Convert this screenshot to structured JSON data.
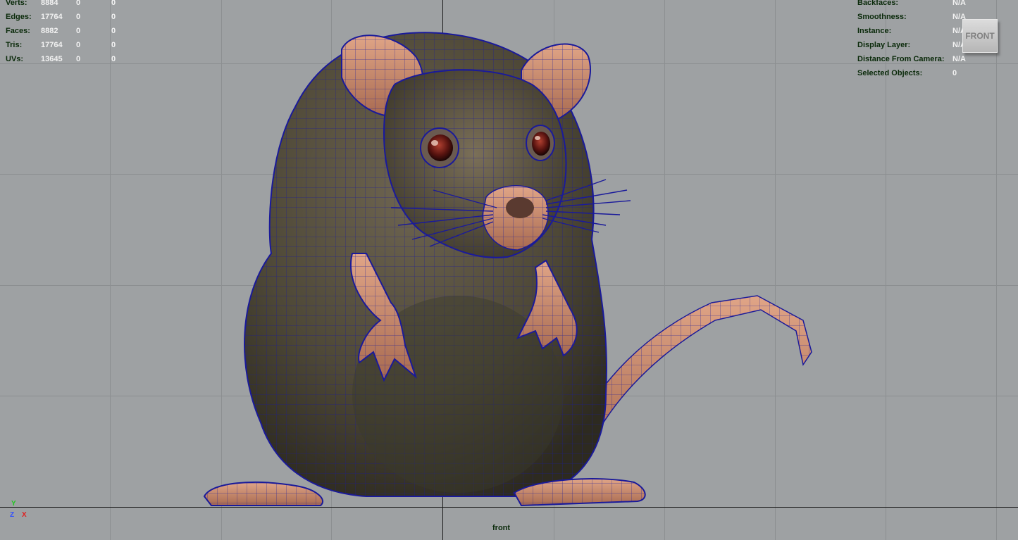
{
  "viewport": {
    "camera_name": "front",
    "view_cube_label": "FRONT"
  },
  "poly_count": [
    {
      "label": "Verts:",
      "values": [
        "8884",
        "0",
        "0"
      ]
    },
    {
      "label": "Edges:",
      "values": [
        "17764",
        "0",
        "0"
      ]
    },
    {
      "label": "Faces:",
      "values": [
        "8882",
        "0",
        "0"
      ]
    },
    {
      "label": "Tris:",
      "values": [
        "17764",
        "0",
        "0"
      ]
    },
    {
      "label": "UVs:",
      "values": [
        "13645",
        "0",
        "0"
      ]
    }
  ],
  "object_details": [
    {
      "label": "Backfaces:",
      "value": "N/A"
    },
    {
      "label": "Smoothness:",
      "value": "N/A"
    },
    {
      "label": "Instance:",
      "value": "N/A"
    },
    {
      "label": "Display Layer:",
      "value": "N/A"
    },
    {
      "label": "Distance From Camera:",
      "value": "N/A"
    },
    {
      "label": "Selected Objects:",
      "value": "0"
    }
  ],
  "axis_gizmo": {
    "y": "Y",
    "z": "Z",
    "x": "X"
  },
  "colors": {
    "background": "#9ea1a3",
    "wireframe": "#1a1a9a",
    "fur": "#5d5440",
    "skin": "#c98a6e",
    "hud_label": "#0a2a0a",
    "hud_value": "#f2f2f2"
  }
}
